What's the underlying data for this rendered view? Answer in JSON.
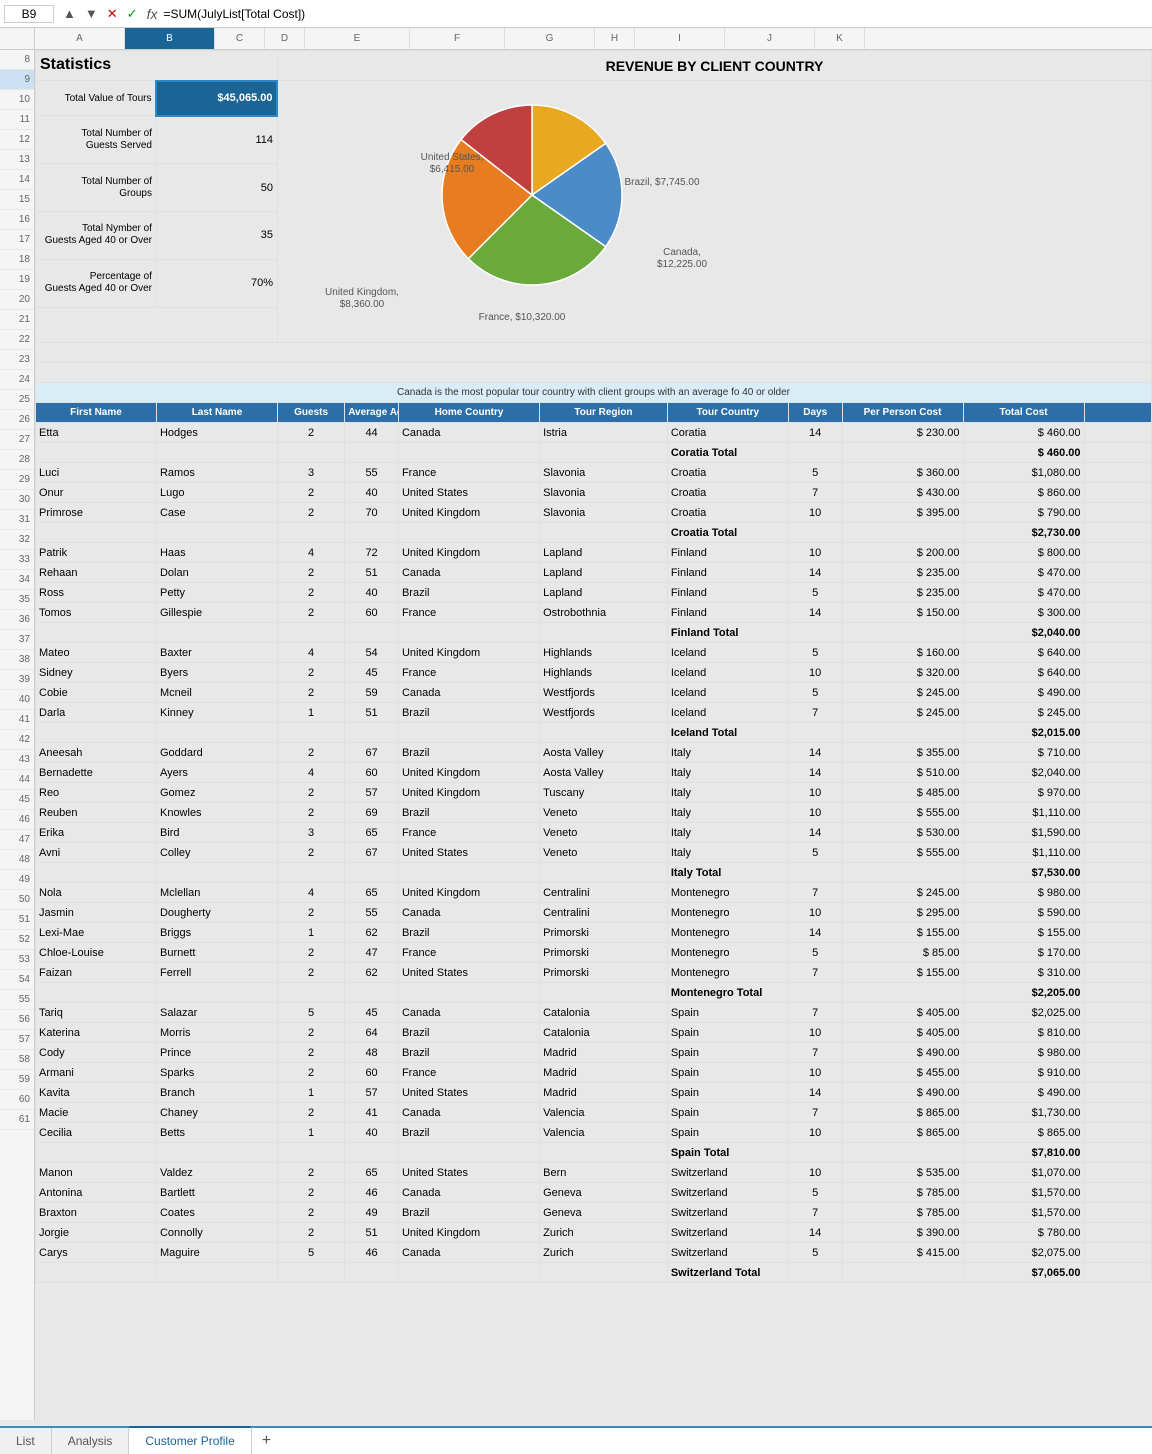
{
  "formulaBar": {
    "cellRef": "B9",
    "formula": "=SUM(JulyList[Total Cost])"
  },
  "tabs": [
    {
      "label": "List",
      "active": false
    },
    {
      "label": "Analysis",
      "active": false
    },
    {
      "label": "Customer Profile",
      "active": true
    }
  ],
  "statistics": {
    "title": "Statistics",
    "rows": [
      {
        "label": "Total Value of Tours Sold",
        "value": "$45,065.00"
      },
      {
        "label": "Total Number of Guests Served",
        "value": "114"
      },
      {
        "label": "Total Number of Groups",
        "value": "50"
      },
      {
        "label": "Total Nymber of Guests Aged 40 or Over",
        "value": "35"
      },
      {
        "label": "Percentage of Guests Aged 40 or Over",
        "value": "70%"
      }
    ]
  },
  "chart": {
    "title": "REVENUE BY CLIENT COUNTRY",
    "slices": [
      {
        "label": "United States, $6,415.00",
        "color": "#e8a820",
        "startAngle": 0,
        "sweepAngle": 55
      },
      {
        "label": "Brazil, $7,745.00",
        "color": "#4b8bc8",
        "startAngle": 55,
        "sweepAngle": 70
      },
      {
        "label": "Canada, $12,225.00",
        "color": "#6aaa3a",
        "startAngle": 125,
        "sweepAngle": 100
      },
      {
        "label": "France, $10,320.00",
        "color": "#e87c20",
        "startAngle": 225,
        "sweepAngle": 83
      },
      {
        "label": "United Kingdom, $8,360.00",
        "color": "#c04040",
        "startAngle": 308,
        "sweepAngle": 52
      }
    ]
  },
  "noteRow17": "Canada is the most popular tour country with client groups with an average fo 40 or older",
  "tableHeaders": [
    "First Name",
    "Last Name",
    "Guests",
    "Average Age",
    "Home Country",
    "Tour Region",
    "Tour Country",
    "Days",
    "Per Person Cost",
    "Total Cost"
  ],
  "tableRows": [
    {
      "row": 19,
      "fn": "Etta",
      "ln": "Hodges",
      "guests": "2",
      "age": "44",
      "home": "Canada",
      "region": "Istria",
      "country": "Coratia",
      "days": "14",
      "ppc": "$ 230.00",
      "total": "$ 460.00"
    },
    {
      "row": 20,
      "fn": "",
      "ln": "",
      "guests": "",
      "age": "",
      "home": "",
      "region": "",
      "country": "Coratia Total",
      "days": "",
      "ppc": "",
      "total": "$ 460.00",
      "subtotal": true
    },
    {
      "row": 21,
      "fn": "Luci",
      "ln": "Ramos",
      "guests": "3",
      "age": "55",
      "home": "France",
      "region": "Slavonia",
      "country": "Croatia",
      "days": "5",
      "ppc": "$ 360.00",
      "total": "$1,080.00"
    },
    {
      "row": 22,
      "fn": "Onur",
      "ln": "Lugo",
      "guests": "2",
      "age": "40",
      "home": "United States",
      "region": "Slavonia",
      "country": "Croatia",
      "days": "7",
      "ppc": "$ 430.00",
      "total": "$ 860.00"
    },
    {
      "row": 23,
      "fn": "Primrose",
      "ln": "Case",
      "guests": "2",
      "age": "70",
      "home": "United Kingdom",
      "region": "Slavonia",
      "country": "Croatia",
      "days": "10",
      "ppc": "$ 395.00",
      "total": "$ 790.00"
    },
    {
      "row": 24,
      "fn": "",
      "ln": "",
      "guests": "",
      "age": "",
      "home": "",
      "region": "",
      "country": "Croatia Total",
      "days": "",
      "ppc": "",
      "total": "$2,730.00",
      "subtotal": true
    },
    {
      "row": 25,
      "fn": "Patrik",
      "ln": "Haas",
      "guests": "4",
      "age": "72",
      "home": "United Kingdom",
      "region": "Lapland",
      "country": "Finland",
      "days": "10",
      "ppc": "$ 200.00",
      "total": "$ 800.00"
    },
    {
      "row": 26,
      "fn": "Rehaan",
      "ln": "Dolan",
      "guests": "2",
      "age": "51",
      "home": "Canada",
      "region": "Lapland",
      "country": "Finland",
      "days": "14",
      "ppc": "$ 235.00",
      "total": "$ 470.00"
    },
    {
      "row": 27,
      "fn": "Ross",
      "ln": "Petty",
      "guests": "2",
      "age": "40",
      "home": "Brazil",
      "region": "Lapland",
      "country": "Finland",
      "days": "5",
      "ppc": "$ 235.00",
      "total": "$ 470.00"
    },
    {
      "row": 28,
      "fn": "Tomos",
      "ln": "Gillespie",
      "guests": "2",
      "age": "60",
      "home": "France",
      "region": "Ostrobothnia",
      "country": "Finland",
      "days": "14",
      "ppc": "$ 150.00",
      "total": "$ 300.00"
    },
    {
      "row": 29,
      "fn": "",
      "ln": "",
      "guests": "",
      "age": "",
      "home": "",
      "region": "",
      "country": "Finland Total",
      "days": "",
      "ppc": "",
      "total": "$2,040.00",
      "subtotal": true
    },
    {
      "row": 30,
      "fn": "Mateo",
      "ln": "Baxter",
      "guests": "4",
      "age": "54",
      "home": "United Kingdom",
      "region": "Highlands",
      "country": "Iceland",
      "days": "5",
      "ppc": "$ 160.00",
      "total": "$ 640.00"
    },
    {
      "row": 31,
      "fn": "Sidney",
      "ln": "Byers",
      "guests": "2",
      "age": "45",
      "home": "France",
      "region": "Highlands",
      "country": "Iceland",
      "days": "10",
      "ppc": "$ 320.00",
      "total": "$ 640.00"
    },
    {
      "row": 32,
      "fn": "Cobie",
      "ln": "Mcneil",
      "guests": "2",
      "age": "59",
      "home": "Canada",
      "region": "Westfjords",
      "country": "Iceland",
      "days": "5",
      "ppc": "$ 245.00",
      "total": "$ 490.00"
    },
    {
      "row": 33,
      "fn": "Darla",
      "ln": "Kinney",
      "guests": "1",
      "age": "51",
      "home": "Brazil",
      "region": "Westfjords",
      "country": "Iceland",
      "days": "7",
      "ppc": "$ 245.00",
      "total": "$ 245.00"
    },
    {
      "row": 34,
      "fn": "",
      "ln": "",
      "guests": "",
      "age": "",
      "home": "",
      "region": "",
      "country": "Iceland Total",
      "days": "",
      "ppc": "",
      "total": "$2,015.00",
      "subtotal": true
    },
    {
      "row": 35,
      "fn": "Aneesah",
      "ln": "Goddard",
      "guests": "2",
      "age": "67",
      "home": "Brazil",
      "region": "Aosta Valley",
      "country": "Italy",
      "days": "14",
      "ppc": "$ 355.00",
      "total": "$ 710.00"
    },
    {
      "row": 36,
      "fn": "Bernadette",
      "ln": "Ayers",
      "guests": "4",
      "age": "60",
      "home": "United Kingdom",
      "region": "Aosta Valley",
      "country": "Italy",
      "days": "14",
      "ppc": "$ 510.00",
      "total": "$2,040.00"
    },
    {
      "row": 37,
      "fn": "Reo",
      "ln": "Gomez",
      "guests": "2",
      "age": "57",
      "home": "United Kingdom",
      "region": "Tuscany",
      "country": "Italy",
      "days": "10",
      "ppc": "$ 485.00",
      "total": "$ 970.00"
    },
    {
      "row": 38,
      "fn": "Reuben",
      "ln": "Knowles",
      "guests": "2",
      "age": "69",
      "home": "Brazil",
      "region": "Veneto",
      "country": "Italy",
      "days": "10",
      "ppc": "$ 555.00",
      "total": "$1,110.00"
    },
    {
      "row": 39,
      "fn": "Erika",
      "ln": "Bird",
      "guests": "3",
      "age": "65",
      "home": "France",
      "region": "Veneto",
      "country": "Italy",
      "days": "14",
      "ppc": "$ 530.00",
      "total": "$1,590.00"
    },
    {
      "row": 40,
      "fn": "Avni",
      "ln": "Colley",
      "guests": "2",
      "age": "67",
      "home": "United States",
      "region": "Veneto",
      "country": "Italy",
      "days": "5",
      "ppc": "$ 555.00",
      "total": "$1,110.00"
    },
    {
      "row": 41,
      "fn": "",
      "ln": "",
      "guests": "",
      "age": "",
      "home": "",
      "region": "",
      "country": "Italy Total",
      "days": "",
      "ppc": "",
      "total": "$7,530.00",
      "subtotal": true
    },
    {
      "row": 42,
      "fn": "Nola",
      "ln": "Mclellan",
      "guests": "4",
      "age": "65",
      "home": "United Kingdom",
      "region": "Centralini",
      "country": "Montenegro",
      "days": "7",
      "ppc": "$ 245.00",
      "total": "$ 980.00"
    },
    {
      "row": 43,
      "fn": "Jasmin",
      "ln": "Dougherty",
      "guests": "2",
      "age": "55",
      "home": "Canada",
      "region": "Centralini",
      "country": "Montenegro",
      "days": "10",
      "ppc": "$ 295.00",
      "total": "$ 590.00"
    },
    {
      "row": 44,
      "fn": "Lexi-Mae",
      "ln": "Briggs",
      "guests": "1",
      "age": "62",
      "home": "Brazil",
      "region": "Primorski",
      "country": "Montenegro",
      "days": "14",
      "ppc": "$ 155.00",
      "total": "$ 155.00"
    },
    {
      "row": 45,
      "fn": "Chloe-Louise",
      "ln": "Burnett",
      "guests": "2",
      "age": "47",
      "home": "France",
      "region": "Primorski",
      "country": "Montenegro",
      "days": "5",
      "ppc": "$ 85.00",
      "total": "$ 170.00"
    },
    {
      "row": 46,
      "fn": "Faizan",
      "ln": "Ferrell",
      "guests": "2",
      "age": "62",
      "home": "United States",
      "region": "Primorski",
      "country": "Montenegro",
      "days": "7",
      "ppc": "$ 155.00",
      "total": "$ 310.00"
    },
    {
      "row": 47,
      "fn": "",
      "ln": "",
      "guests": "",
      "age": "",
      "home": "",
      "region": "",
      "country": "Montenegro Total",
      "days": "",
      "ppc": "",
      "total": "$2,205.00",
      "subtotal": true
    },
    {
      "row": 48,
      "fn": "Tariq",
      "ln": "Salazar",
      "guests": "5",
      "age": "45",
      "home": "Canada",
      "region": "Catalonia",
      "country": "Spain",
      "days": "7",
      "ppc": "$ 405.00",
      "total": "$2,025.00"
    },
    {
      "row": 49,
      "fn": "Katerina",
      "ln": "Morris",
      "guests": "2",
      "age": "64",
      "home": "Brazil",
      "region": "Catalonia",
      "country": "Spain",
      "days": "10",
      "ppc": "$ 405.00",
      "total": "$ 810.00"
    },
    {
      "row": 50,
      "fn": "Cody",
      "ln": "Prince",
      "guests": "2",
      "age": "48",
      "home": "Brazil",
      "region": "Madrid",
      "country": "Spain",
      "days": "7",
      "ppc": "$ 490.00",
      "total": "$ 980.00"
    },
    {
      "row": 51,
      "fn": "Armani",
      "ln": "Sparks",
      "guests": "2",
      "age": "60",
      "home": "France",
      "region": "Madrid",
      "country": "Spain",
      "days": "10",
      "ppc": "$ 455.00",
      "total": "$ 910.00"
    },
    {
      "row": 52,
      "fn": "Kavita",
      "ln": "Branch",
      "guests": "1",
      "age": "57",
      "home": "United States",
      "region": "Madrid",
      "country": "Spain",
      "days": "14",
      "ppc": "$ 490.00",
      "total": "$ 490.00"
    },
    {
      "row": 53,
      "fn": "Macie",
      "ln": "Chaney",
      "guests": "2",
      "age": "41",
      "home": "Canada",
      "region": "Valencia",
      "country": "Spain",
      "days": "7",
      "ppc": "$ 865.00",
      "total": "$1,730.00"
    },
    {
      "row": 54,
      "fn": "Cecilia",
      "ln": "Betts",
      "guests": "1",
      "age": "40",
      "home": "Brazil",
      "region": "Valencia",
      "country": "Spain",
      "days": "10",
      "ppc": "$ 865.00",
      "total": "$ 865.00"
    },
    {
      "row": 55,
      "fn": "",
      "ln": "",
      "guests": "",
      "age": "",
      "home": "",
      "region": "",
      "country": "Spain Total",
      "days": "",
      "ppc": "",
      "total": "$7,810.00",
      "subtotal": true
    },
    {
      "row": 56,
      "fn": "Manon",
      "ln": "Valdez",
      "guests": "2",
      "age": "65",
      "home": "United States",
      "region": "Bern",
      "country": "Switzerland",
      "days": "10",
      "ppc": "$ 535.00",
      "total": "$1,070.00"
    },
    {
      "row": 57,
      "fn": "Antonina",
      "ln": "Bartlett",
      "guests": "2",
      "age": "46",
      "home": "Canada",
      "region": "Geneva",
      "country": "Switzerland",
      "days": "5",
      "ppc": "$ 785.00",
      "total": "$1,570.00"
    },
    {
      "row": 58,
      "fn": "Braxton",
      "ln": "Coates",
      "guests": "2",
      "age": "49",
      "home": "Brazil",
      "region": "Geneva",
      "country": "Switzerland",
      "days": "7",
      "ppc": "$ 785.00",
      "total": "$1,570.00"
    },
    {
      "row": 59,
      "fn": "Jorgie",
      "ln": "Connolly",
      "guests": "2",
      "age": "51",
      "home": "United Kingdom",
      "region": "Zurich",
      "country": "Switzerland",
      "days": "14",
      "ppc": "$ 390.00",
      "total": "$ 780.00"
    },
    {
      "row": 60,
      "fn": "Carys",
      "ln": "Maguire",
      "guests": "5",
      "age": "46",
      "home": "Canada",
      "region": "Zurich",
      "country": "Switzerland",
      "days": "5",
      "ppc": "$ 415.00",
      "total": "$2,075.00"
    },
    {
      "row": 61,
      "fn": "",
      "ln": "",
      "guests": "",
      "age": "",
      "home": "",
      "region": "",
      "country": "Switzerland Total",
      "days": "",
      "ppc": "",
      "total": "$7,065.00",
      "subtotal": true
    }
  ]
}
